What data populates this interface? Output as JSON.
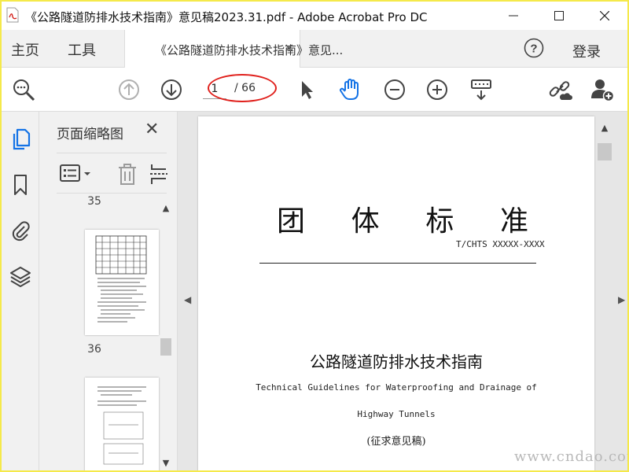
{
  "window": {
    "title": "《公路隧道防排水技术指南》意见稿2023.31.pdf - Adobe Acrobat Pro DC"
  },
  "menu": {
    "home": "主页",
    "tools": "工具",
    "doc_tab": "《公路隧道防排水技术指南》意见...",
    "doc_tab_close": "×",
    "login": "登录"
  },
  "toolbar": {
    "current_page": "1",
    "total_pages": "/ 66"
  },
  "thumbnails": {
    "title": "页面缩略图",
    "close": "✕",
    "pages": [
      {
        "label": "35"
      },
      {
        "label": "36"
      }
    ]
  },
  "document": {
    "standard_title": [
      "团",
      "体",
      "标",
      "准"
    ],
    "standard_code": "T/CHTS XXXXX-XXXX",
    "title_cn": "公路隧道防排水技术指南",
    "title_en_line1": "Technical Guidelines for Waterproofing and Drainage of",
    "title_en_line2": "Highway Tunnels",
    "draft_note": "(征求意见稿)"
  },
  "watermark": "www.cndao.com",
  "colors": {
    "frame": "#f5e94a",
    "highlight_ellipse": "#e0201c",
    "pan_tool_active": "#1473e6"
  }
}
